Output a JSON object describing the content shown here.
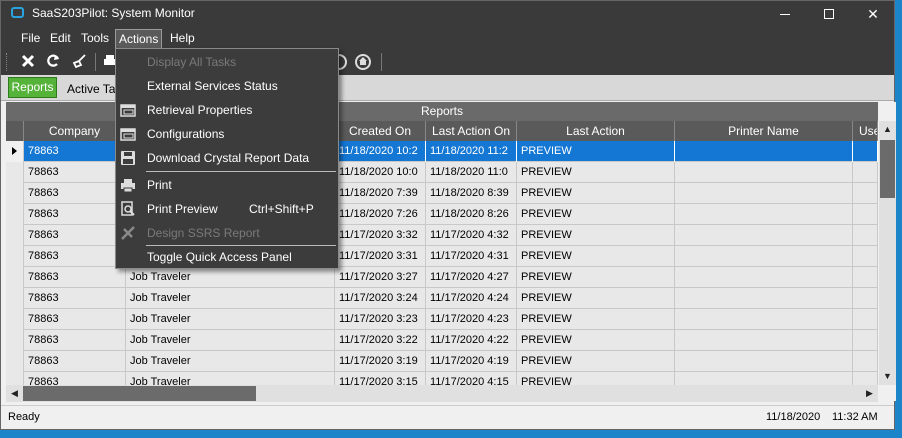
{
  "window": {
    "title": "SaaS203Pilot: System Monitor",
    "close_glyph": "✕"
  },
  "menubar": {
    "items": [
      "File",
      "Edit",
      "Tools",
      "Actions",
      "Help"
    ],
    "active": "Actions"
  },
  "toolbar": {
    "buttons": [
      "close-icon",
      "refresh-icon",
      "clear-icon",
      "print-icon",
      "help-icon",
      "home-icon"
    ]
  },
  "tabs": {
    "reports": "Reports",
    "active_tasks": "Active Ta"
  },
  "grid": {
    "band_title": "Reports",
    "columns": [
      "Company",
      "",
      "Created On",
      "Last Action On",
      "Last Action",
      "Printer Name",
      "Use"
    ],
    "rows": [
      {
        "company": "78863",
        "description": "",
        "created_on": "11/18/2020 10:2",
        "last_action_on": "11/18/2020 11:2",
        "last_action": "PREVIEW",
        "printer": "",
        "user": ""
      },
      {
        "company": "78863",
        "description": "",
        "created_on": "11/18/2020 10:0",
        "last_action_on": "11/18/2020 11:0",
        "last_action": "PREVIEW",
        "printer": "",
        "user": ""
      },
      {
        "company": "78863",
        "description": "",
        "created_on": "11/18/2020 7:39",
        "last_action_on": "11/18/2020 8:39",
        "last_action": "PREVIEW",
        "printer": "",
        "user": ""
      },
      {
        "company": "78863",
        "description": "",
        "created_on": "11/18/2020 7:26",
        "last_action_on": "11/18/2020 8:26",
        "last_action": "PREVIEW",
        "printer": "",
        "user": ""
      },
      {
        "company": "78863",
        "description": "",
        "created_on": "11/17/2020 3:32",
        "last_action_on": "11/17/2020 4:32",
        "last_action": "PREVIEW",
        "printer": "",
        "user": ""
      },
      {
        "company": "78863",
        "description": "",
        "created_on": "11/17/2020 3:31",
        "last_action_on": "11/17/2020 4:31",
        "last_action": "PREVIEW",
        "printer": "",
        "user": ""
      },
      {
        "company": "78863",
        "description": "Job Traveler",
        "created_on": "11/17/2020 3:27",
        "last_action_on": "11/17/2020 4:27",
        "last_action": "PREVIEW",
        "printer": "",
        "user": ""
      },
      {
        "company": "78863",
        "description": "Job Traveler",
        "created_on": "11/17/2020 3:24",
        "last_action_on": "11/17/2020 4:24",
        "last_action": "PREVIEW",
        "printer": "",
        "user": ""
      },
      {
        "company": "78863",
        "description": "Job Traveler",
        "created_on": "11/17/2020 3:23",
        "last_action_on": "11/17/2020 4:23",
        "last_action": "PREVIEW",
        "printer": "",
        "user": ""
      },
      {
        "company": "78863",
        "description": "Job Traveler",
        "created_on": "11/17/2020 3:22",
        "last_action_on": "11/17/2020 4:22",
        "last_action": "PREVIEW",
        "printer": "",
        "user": ""
      },
      {
        "company": "78863",
        "description": "Job Traveler",
        "created_on": "11/17/2020 3:19",
        "last_action_on": "11/17/2020 4:19",
        "last_action": "PREVIEW",
        "printer": "",
        "user": ""
      },
      {
        "company": "78863",
        "description": "Job Traveler",
        "created_on": "11/17/2020 3:15",
        "last_action_on": "11/17/2020 4:15",
        "last_action": "PREVIEW",
        "printer": "",
        "user": ""
      }
    ]
  },
  "actions_menu": {
    "items": [
      {
        "label": "Display All Tasks",
        "disabled": true,
        "icon": ""
      },
      {
        "label": "External Services Status",
        "disabled": false,
        "icon": ""
      },
      {
        "label": "Retrieval  Properties",
        "disabled": false,
        "icon": "window-icon"
      },
      {
        "label": "Configurations",
        "disabled": false,
        "icon": "window-icon"
      },
      {
        "label": "Download Crystal Report Data",
        "disabled": false,
        "icon": "save-icon"
      },
      {
        "label": "Print",
        "disabled": false,
        "icon": "print-icon"
      },
      {
        "label": "Print Preview",
        "shortcut": "Ctrl+Shift+P",
        "disabled": false,
        "icon": "print-preview-icon"
      },
      {
        "label": "Design SSRS Report",
        "disabled": true,
        "icon": "design-icon"
      },
      {
        "label": "Toggle Quick Access Panel",
        "disabled": false,
        "icon": ""
      }
    ]
  },
  "status": {
    "text": "Ready",
    "date": "11/18/2020",
    "time": "11:32 AM"
  }
}
